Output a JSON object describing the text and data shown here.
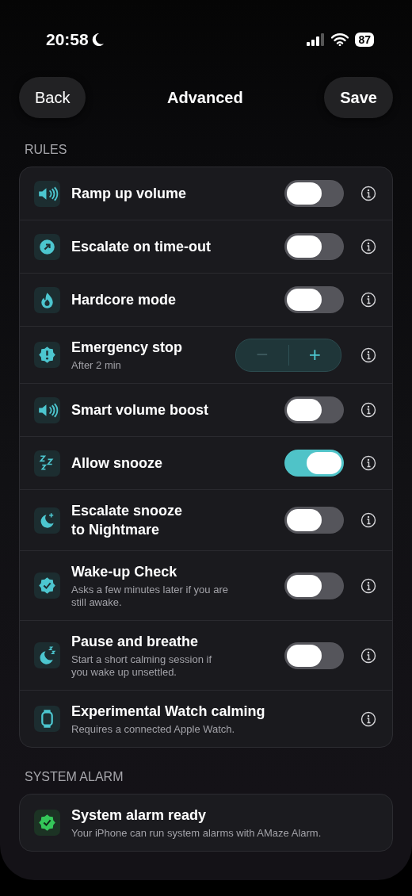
{
  "status_bar": {
    "time": "20:58",
    "battery": "87"
  },
  "header": {
    "back": "Back",
    "title": "Advanced",
    "save": "Save"
  },
  "rules": {
    "heading": "RULES",
    "items": [
      {
        "kind": "toggle",
        "label": "Ramp up volume",
        "on": false
      },
      {
        "kind": "toggle",
        "label": "Escalate on time-out",
        "on": false
      },
      {
        "kind": "toggle",
        "label": "Hardcore mode",
        "on": false
      },
      {
        "kind": "stepper",
        "label": "Emergency stop",
        "detail": "After 2 min",
        "minus_disabled": true,
        "minus": "−",
        "plus": "+"
      },
      {
        "kind": "toggle",
        "label": "Smart volume boost",
        "on": false
      },
      {
        "kind": "toggle",
        "label": "Allow snooze",
        "on": true
      },
      {
        "kind": "toggle",
        "label": "Escalate snooze to Nightmare",
        "on": false
      },
      {
        "kind": "toggle",
        "label": "Wake-up Check",
        "detail": "Asks a few minutes later if you are still awake.",
        "on": false
      },
      {
        "kind": "toggle",
        "label": "Pause and breathe",
        "detail": "Start a short calming session if you wake up unsettled.",
        "on": false
      },
      {
        "kind": "info",
        "label": "Experimental Watch calming",
        "detail": "Requires a connected Apple Watch."
      }
    ]
  },
  "system_alarm": {
    "heading": "SYSTEM ALARM",
    "title": "System alarm ready",
    "detail": "Your iPhone can run system alarms with AMaze Alarm."
  }
}
